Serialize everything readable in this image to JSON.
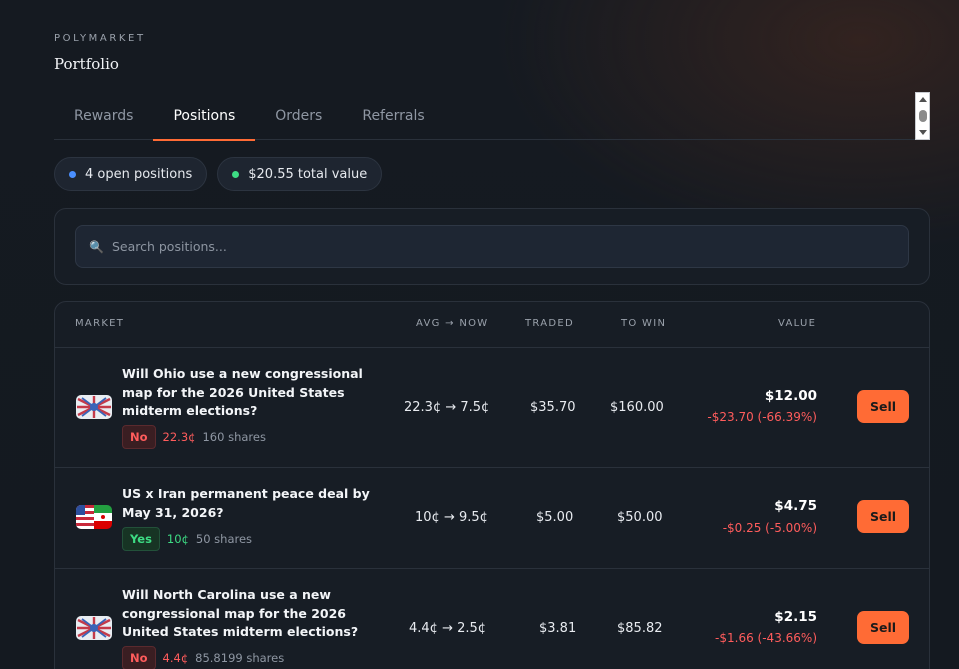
{
  "brand": "POLYMARKET",
  "page_title": "Portfolio",
  "tabs": [
    {
      "label": "Rewards",
      "active": false
    },
    {
      "label": "Positions",
      "active": true
    },
    {
      "label": "Orders",
      "active": false
    },
    {
      "label": "Referrals",
      "active": false
    }
  ],
  "summary": {
    "open_positions": "4 open positions",
    "total_value": "$20.55 total value",
    "open_dot_color": "#4a8fff",
    "value_dot_color": "#3ddc84"
  },
  "search": {
    "icon": "search-icon",
    "placeholder": "Search positions..."
  },
  "table": {
    "headers": {
      "market": "MARKET",
      "avg_now": "AVG → NOW",
      "traded": "TRADED",
      "to_win": "TO WIN",
      "value": "VALUE"
    },
    "rows": [
      {
        "title_lines": [
          "Will Ohio use a new congressional",
          "map for the 2026 United States",
          "midterm elections?"
        ],
        "icon": "us-map-flag-icon",
        "outcome": "No",
        "outcome_price": "22.3¢",
        "shares": "160 shares",
        "avg_now": "22.3¢ → 7.5¢",
        "traded": "$35.70",
        "to_win": "$160.00",
        "value": "$12.00",
        "change": "-$23.70 (-66.39%)",
        "sell_label": "Sell"
      },
      {
        "title_lines": [
          "US x Iran permanent peace deal by",
          "May 31, 2026?"
        ],
        "icon": "us-iran-flag-icon",
        "outcome": "Yes",
        "outcome_price": "10¢",
        "shares": "50 shares",
        "avg_now": "10¢ → 9.5¢",
        "traded": "$5.00",
        "to_win": "$50.00",
        "value": "$4.75",
        "change": "-$0.25 (-5.00%)",
        "sell_label": "Sell"
      },
      {
        "title_lines": [
          "Will North Carolina use a new",
          "congressional map for the 2026",
          "United States midterm elections?"
        ],
        "icon": "us-map-flag-icon",
        "outcome": "No",
        "outcome_price": "4.4¢",
        "shares": "85.8199 shares",
        "avg_now": "4.4¢ → 2.5¢",
        "traded": "$3.81",
        "to_win": "$85.82",
        "value": "$2.15",
        "change": "-$1.66 (-43.66%)",
        "sell_label": "Sell"
      }
    ]
  },
  "colors": {
    "accent": "#ff6b35",
    "negative": "#ff5c5c",
    "positive": "#3ddc84"
  }
}
